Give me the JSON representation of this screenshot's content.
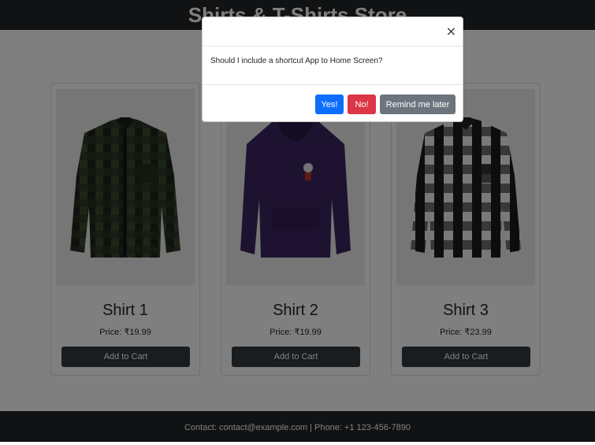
{
  "header": {
    "title": "Shirts & T-Shirts Store"
  },
  "products": [
    {
      "name": "Shirt 1",
      "price": "Price: ₹19.99",
      "cta": "Add to Cart"
    },
    {
      "name": "Shirt 2",
      "price": "Price: ₹19.99",
      "cta": "Add to Cart"
    },
    {
      "name": "Shirt 3",
      "price": "Price: ₹23.99",
      "cta": "Add to Cart"
    }
  ],
  "footer": {
    "text": "Contact: contact@example.com | Phone: +1 123-456-7890"
  },
  "modal": {
    "close": "×",
    "message": "Should I include a shortcut App to Home Screen?",
    "yes": "Yes!",
    "no": "No!",
    "later": "Remind me later"
  },
  "colors": {
    "dark": "#212529",
    "primary": "#0d6efd",
    "danger": "#dc3545",
    "secondary": "#6c757d"
  }
}
